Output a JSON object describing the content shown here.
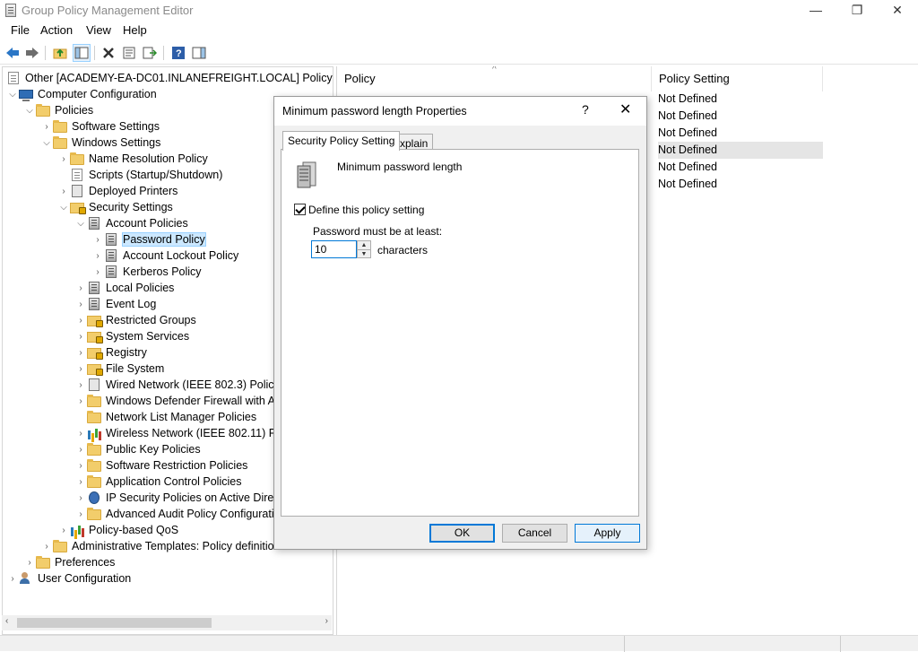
{
  "window": {
    "title": "Group Policy Management Editor",
    "minimize": "—",
    "maximize": "❐",
    "close": "✕"
  },
  "menu": {
    "file": "File",
    "action": "Action",
    "view": "View",
    "help": "Help"
  },
  "tree": {
    "root": "Other [ACADEMY-EA-DC01.INLANEFREIGHT.LOCAL] Policy",
    "computer_configuration": "Computer Configuration",
    "policies": "Policies",
    "software_settings": "Software Settings",
    "windows_settings": "Windows Settings",
    "name_resolution_policy": "Name Resolution Policy",
    "scripts": "Scripts (Startup/Shutdown)",
    "deployed_printers": "Deployed Printers",
    "security_settings": "Security Settings",
    "account_policies": "Account Policies",
    "password_policy": "Password Policy",
    "account_lockout_policy": "Account Lockout Policy",
    "kerberos_policy": "Kerberos Policy",
    "local_policies": "Local Policies",
    "event_log": "Event Log",
    "restricted_groups": "Restricted Groups",
    "system_services": "System Services",
    "registry": "Registry",
    "file_system": "File System",
    "wired_network": "Wired Network (IEEE 802.3) Policies",
    "windows_defender_firewall": "Windows Defender Firewall with Ad",
    "network_list_manager": "Network List Manager Policies",
    "wireless_network": "Wireless Network (IEEE 802.11) Poli",
    "public_key_policies": "Public Key Policies",
    "software_restriction": "Software Restriction Policies",
    "application_control": "Application Control Policies",
    "ip_security": "IP Security Policies on Active Direct",
    "advanced_audit": "Advanced Audit Policy Configurati",
    "policy_qos": "Policy-based QoS",
    "admin_templates": "Administrative Templates: Policy definition",
    "preferences": "Preferences",
    "user_configuration": "User Configuration"
  },
  "list": {
    "col_policy": "Policy",
    "col_setting": "Policy Setting",
    "values": [
      "Not Defined",
      "Not Defined",
      "Not Defined",
      "Not Defined",
      "Not Defined",
      "Not Defined"
    ]
  },
  "dialog": {
    "title": "Minimum password length Properties",
    "help": "?",
    "close": "✕",
    "tab_setting": "Security Policy Setting",
    "tab_explain": "Explain",
    "policy_name": "Minimum password length",
    "define_label": "Define this policy setting",
    "password_label": "Password must be at least:",
    "password_value": "10",
    "characters": "characters",
    "ok": "OK",
    "cancel": "Cancel",
    "apply": "Apply"
  }
}
